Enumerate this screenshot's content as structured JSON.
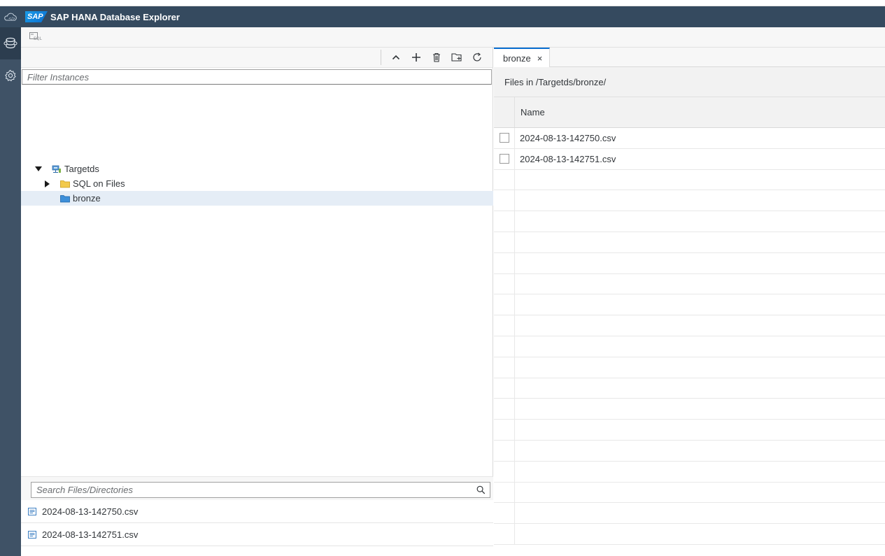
{
  "app": {
    "title": "SAP HANA Database Explorer",
    "logo": "SAP"
  },
  "sqlbar": {
    "icon": "sql-console-icon"
  },
  "left_toolbar": {
    "icons": [
      "collapse-icon",
      "add-icon",
      "delete-icon",
      "add-folder-icon",
      "refresh-icon"
    ]
  },
  "filter": {
    "placeholder": "Filter Instances",
    "value": ""
  },
  "tree": {
    "root": {
      "label": "Targetds",
      "expanded": true
    },
    "children": [
      {
        "label": "SQL on Files",
        "expanded": false
      },
      {
        "label": "bronze",
        "selected": true
      }
    ]
  },
  "file_search": {
    "placeholder": "Search Files/Directories",
    "value": ""
  },
  "file_list": [
    {
      "name": "2024-08-13-142750.csv"
    },
    {
      "name": "2024-08-13-142751.csv"
    }
  ],
  "editor": {
    "tabs": [
      {
        "label": "bronze",
        "close": "×"
      }
    ],
    "path_label": "Files in /Targetds/bronze/",
    "columns": [
      "Name"
    ],
    "rows": [
      {
        "name": "2024-08-13-142750.csv"
      },
      {
        "name": "2024-08-13-142751.csv"
      }
    ],
    "empty_rows": 18
  },
  "colors": {
    "shell": "#354a5f",
    "rail": "#3f5266",
    "accent": "#0a6ed1",
    "selected": "#e5edf6"
  }
}
